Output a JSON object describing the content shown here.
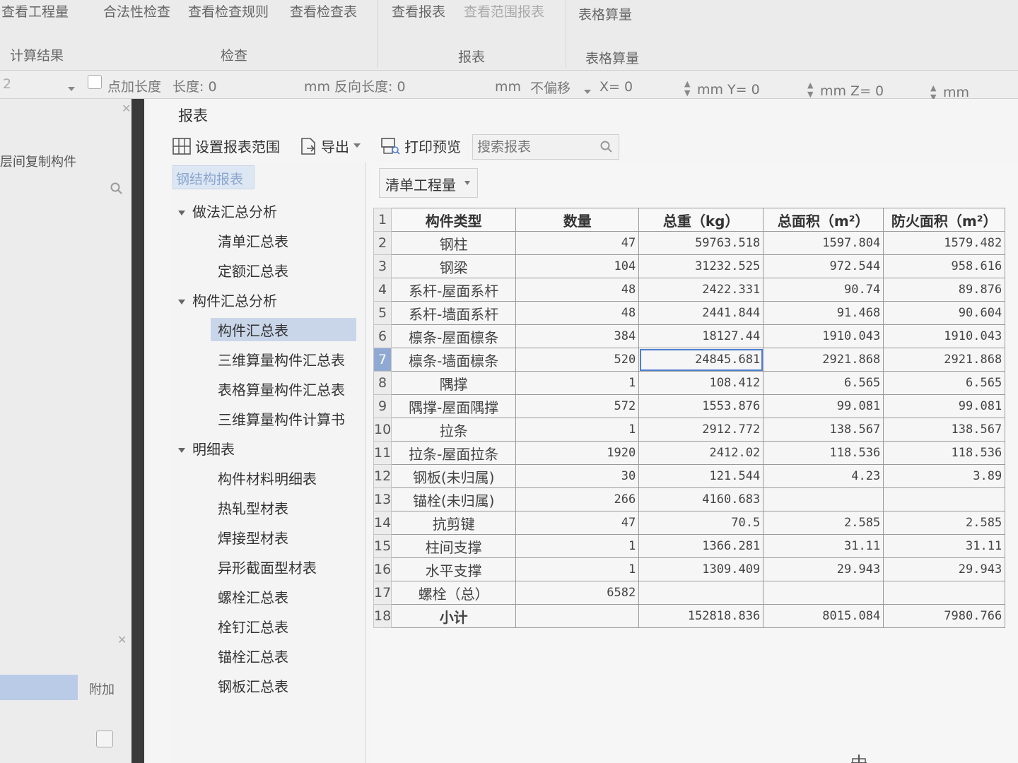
{
  "ribbon": {
    "buttons": [
      "查看工程量",
      "合法性检查",
      "查看检查规则",
      "查看检查表",
      "查看报表",
      "查看范围报表",
      "表格算量"
    ],
    "groups": [
      "计算结果",
      "检查",
      "报表",
      "表格算量"
    ]
  },
  "optbar": {
    "combo_value": "2",
    "add_length_label": "点加长度",
    "length_label": "长度: 0",
    "mm_reverse": "mm 反向长度: 0",
    "mm": "mm",
    "offset_value": "不偏移",
    "x": "X= 0",
    "mm_y": "mm Y= 0",
    "mm_z": "mm Z= 0",
    "mm_end": "mm"
  },
  "left_panel": {
    "copy_label": "层间复制构件",
    "attach_label": "附加"
  },
  "report": {
    "title": "报表",
    "toolbar": {
      "set_range": "设置报表范围",
      "export": "导出",
      "print_preview": "打印预览",
      "search_placeholder": "搜索报表"
    },
    "tree": {
      "tab": "钢结构报表",
      "groups": [
        {
          "label": "做法汇总分析",
          "items": [
            "清单汇总表",
            "定额汇总表"
          ]
        },
        {
          "label": "构件汇总分析",
          "items": [
            "构件汇总表",
            "三维算量构件汇总表",
            "表格算量构件汇总表",
            "三维算量构件计算书"
          ]
        },
        {
          "label": "明细表",
          "items": [
            "构件材料明细表",
            "热轧型材表",
            "焊接型材表",
            "异形截面型材表",
            "螺栓汇总表",
            "栓钉汇总表",
            "锚栓汇总表",
            "钢板汇总表"
          ]
        }
      ],
      "selected": "构件汇总表"
    },
    "dropdown_value": "清单工程量",
    "table": {
      "headers": [
        "构件类型",
        "数量",
        "总重（kg）",
        "总面积（m²）",
        "防火面积（m²）"
      ],
      "rows": [
        [
          "钢柱",
          "47",
          "59763.518",
          "1597.804",
          "1579.482"
        ],
        [
          "钢梁",
          "104",
          "31232.525",
          "972.544",
          "958.616"
        ],
        [
          "系杆-屋面系杆",
          "48",
          "2422.331",
          "90.74",
          "89.876"
        ],
        [
          "系杆-墙面系杆",
          "48",
          "2441.844",
          "91.468",
          "90.604"
        ],
        [
          "檩条-屋面檩条",
          "384",
          "18127.44",
          "1910.043",
          "1910.043"
        ],
        [
          "檩条-墙面檩条",
          "520",
          "24845.681",
          "2921.868",
          "2921.868"
        ],
        [
          "隅撑",
          "1",
          "108.412",
          "6.565",
          "6.565"
        ],
        [
          "隅撑-屋面隅撑",
          "572",
          "1553.876",
          "99.081",
          "99.081"
        ],
        [
          "拉条",
          "1",
          "2912.772",
          "138.567",
          "138.567"
        ],
        [
          "拉条-屋面拉条",
          "1920",
          "2412.02",
          "118.536",
          "118.536"
        ],
        [
          "钢板(未归属)",
          "30",
          "121.544",
          "4.23",
          "3.89"
        ],
        [
          "锚栓(未归属)",
          "266",
          "4160.683",
          "",
          ""
        ],
        [
          "抗剪键",
          "47",
          "70.5",
          "2.585",
          "2.585"
        ],
        [
          "柱间支撑",
          "1",
          "1366.281",
          "31.11",
          "31.11"
        ],
        [
          "水平支撑",
          "1",
          "1309.409",
          "29.943",
          "29.943"
        ],
        [
          "螺栓（总）",
          "6582",
          "",
          "",
          ""
        ],
        [
          "小计",
          "",
          "152818.836",
          "8015.084",
          "7980.766"
        ]
      ],
      "selected_row": 7
    }
  }
}
